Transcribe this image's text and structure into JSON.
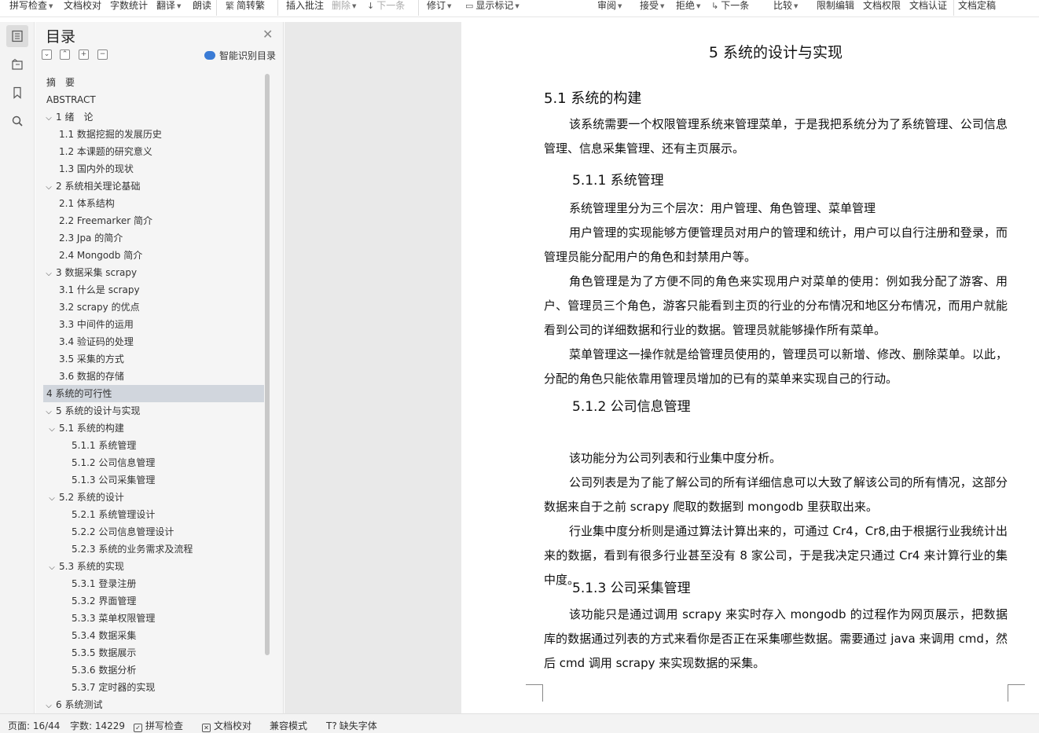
{
  "toolbar": {
    "items": [
      {
        "label": "拼写检查",
        "dropdown": true
      },
      {
        "label": "文档校对",
        "dropdown": false
      },
      {
        "label": "字数统计",
        "dropdown": false
      },
      {
        "label": "翻译",
        "dropdown": true
      },
      {
        "label": "朗读",
        "dropdown": false
      },
      {
        "label": "简转繁",
        "dropdown": false
      },
      {
        "label": "插入批注",
        "dropdown": false
      },
      {
        "label": "删除",
        "dropdown": true,
        "disabled": true
      },
      {
        "label": "下一条",
        "dropdown": false,
        "disabled": true
      },
      {
        "label": "修订",
        "dropdown": true
      },
      {
        "label": "显示标记",
        "dropdown": true
      },
      {
        "label": "审阅",
        "dropdown": true
      },
      {
        "label": "接受",
        "dropdown": true
      },
      {
        "label": "拒绝",
        "dropdown": true
      },
      {
        "label": "下一条",
        "dropdown": false
      },
      {
        "label": "比较",
        "dropdown": true
      },
      {
        "label": "限制编辑",
        "dropdown": false
      },
      {
        "label": "文档权限",
        "dropdown": false
      },
      {
        "label": "文档认证",
        "dropdown": false
      },
      {
        "label": "文档定稿",
        "dropdown": false
      }
    ]
  },
  "nav": {
    "title": "目录",
    "smart_label": "智能识别目录",
    "toc": [
      {
        "label": "摘　要",
        "level": 1,
        "chevron": false
      },
      {
        "label": "ABSTRACT",
        "level": 1,
        "chevron": false
      },
      {
        "label": "1  绪　论",
        "level": 1,
        "chevron": true
      },
      {
        "label": "1.1  数据挖掘的发展历史",
        "level": 2,
        "chevron": false
      },
      {
        "label": "1.2  本课题的研究意义",
        "level": 2,
        "chevron": false
      },
      {
        "label": "1.3  国内外的现状",
        "level": 2,
        "chevron": false
      },
      {
        "label": "2  系统相关理论基础",
        "level": 1,
        "chevron": true
      },
      {
        "label": "2.1  体系结构",
        "level": 2,
        "chevron": false
      },
      {
        "label": "2.2 Freemarker 简介",
        "level": 2,
        "chevron": false
      },
      {
        "label": "2.3 Jpa 的简介",
        "level": 2,
        "chevron": false
      },
      {
        "label": "2.4 Mongodb 简介",
        "level": 2,
        "chevron": false
      },
      {
        "label": "3  数据采集 scrapy",
        "level": 1,
        "chevron": true
      },
      {
        "label": "3.1  什么是 scrapy",
        "level": 2,
        "chevron": false
      },
      {
        "label": "3.2 scrapy 的优点",
        "level": 2,
        "chevron": false
      },
      {
        "label": "3.3  中间件的运用",
        "level": 2,
        "chevron": false
      },
      {
        "label": "3.4  验证码的处理",
        "level": 2,
        "chevron": false
      },
      {
        "label": "3.5  采集的方式",
        "level": 2,
        "chevron": false
      },
      {
        "label": "3.6  数据的存储",
        "level": 2,
        "chevron": false
      },
      {
        "label": "4  系统的可行性",
        "level": 1,
        "chevron": false,
        "selected": true
      },
      {
        "label": "5  系统的设计与实现",
        "level": 1,
        "chevron": true
      },
      {
        "label": "5.1  系统的构建",
        "level": 2,
        "chevron": true
      },
      {
        "label": "5.1.1  系统管理",
        "level": 3,
        "chevron": false
      },
      {
        "label": "5.1.2  公司信息管理",
        "level": 3,
        "chevron": false
      },
      {
        "label": "5.1.3  公司采集管理",
        "level": 3,
        "chevron": false
      },
      {
        "label": "5.2  系统的设计",
        "level": 2,
        "chevron": true
      },
      {
        "label": "5.2.1  系统管理设计",
        "level": 3,
        "chevron": false
      },
      {
        "label": "5.2.2  公司信息管理设计",
        "level": 3,
        "chevron": false
      },
      {
        "label": "5.2.3  系统的业务需求及流程",
        "level": 3,
        "chevron": false
      },
      {
        "label": "5.3  系统的实现",
        "level": 2,
        "chevron": true
      },
      {
        "label": "5.3.1  登录注册",
        "level": 3,
        "chevron": false
      },
      {
        "label": "5.3.2  界面管理",
        "level": 3,
        "chevron": false
      },
      {
        "label": "5.3.3  菜单权限管理",
        "level": 3,
        "chevron": false
      },
      {
        "label": "5.3.4  数据采集",
        "level": 3,
        "chevron": false
      },
      {
        "label": "5.3.5  数据展示",
        "level": 3,
        "chevron": false
      },
      {
        "label": "5.3.6  数据分析",
        "level": 3,
        "chevron": false
      },
      {
        "label": "5.3.7  定时器的实现",
        "level": 3,
        "chevron": false
      },
      {
        "label": "6  系统测试",
        "level": 1,
        "chevron": true
      }
    ]
  },
  "doc": {
    "chapter_title": "5  系统的设计与实现",
    "blocks": [
      {
        "type": "h2",
        "text": "5.1  系统的构建"
      },
      {
        "type": "p",
        "text": "该系统需要一个权限管理系统来管理菜单，于是我把系统分为了系统管理、公司信息管理、信息采集管理、还有主页展示。"
      },
      {
        "type": "h3",
        "text": "5.1.1  系统管理"
      },
      {
        "type": "p",
        "text": "系统管理里分为三个层次：用户管理、角色管理、菜单管理"
      },
      {
        "type": "p",
        "text": "用户管理的实现能够方便管理员对用户的管理和统计，用户可以自行注册和登录，而管理员能分配用户的角色和封禁用户等。"
      },
      {
        "type": "p",
        "text": "角色管理是为了方便不同的角色来实现用户对菜单的使用：例如我分配了游客、用户、管理员三个角色，游客只能看到主页的行业的分布情况和地区分布情况，而用户就能看到公司的详细数据和行业的数据。管理员就能够操作所有菜单。"
      },
      {
        "type": "p",
        "text": "菜单管理这一操作就是给管理员使用的，管理员可以新增、修改、删除菜单。以此，分配的角色只能依靠用管理员增加的已有的菜单来实现自己的行动。"
      },
      {
        "type": "h3",
        "text": "5.1.2  公司信息管理"
      },
      {
        "type": "p",
        "text": "该功能分为公司列表和行业集中度分析。"
      },
      {
        "type": "p",
        "text": "公司列表是为了能了解公司的所有详细信息可以大致了解该公司的所有情况，这部分数据来自于之前 scrapy 爬取的数据到 mongodb 里获取出来。"
      },
      {
        "type": "p",
        "text": "行业集中度分析则是通过算法计算出来的，可通过 Cr4，Cr8,由于根据行业我统计出来的数据，看到有很多行业甚至没有 8 家公司，于是我决定只通过 Cr4 来计算行业的集中度。"
      },
      {
        "type": "h3",
        "text": "5.1.3  公司采集管理"
      },
      {
        "type": "p",
        "text": "该功能只是通过调用 scrapy 来实时存入 mongodb 的过程作为网页展示，把数据库的数据通过列表的方式来看你是否正在采集哪些数据。需要通过 java 来调用 cmd，然后 cmd 调用 scrapy 来实现数据的采集。"
      }
    ]
  },
  "status": {
    "page": "页面: 16/44",
    "words": "字数: 14229",
    "spell": "拼写检查",
    "proof": "文档校对",
    "compat": "兼容模式",
    "missing_font": "缺失字体"
  }
}
